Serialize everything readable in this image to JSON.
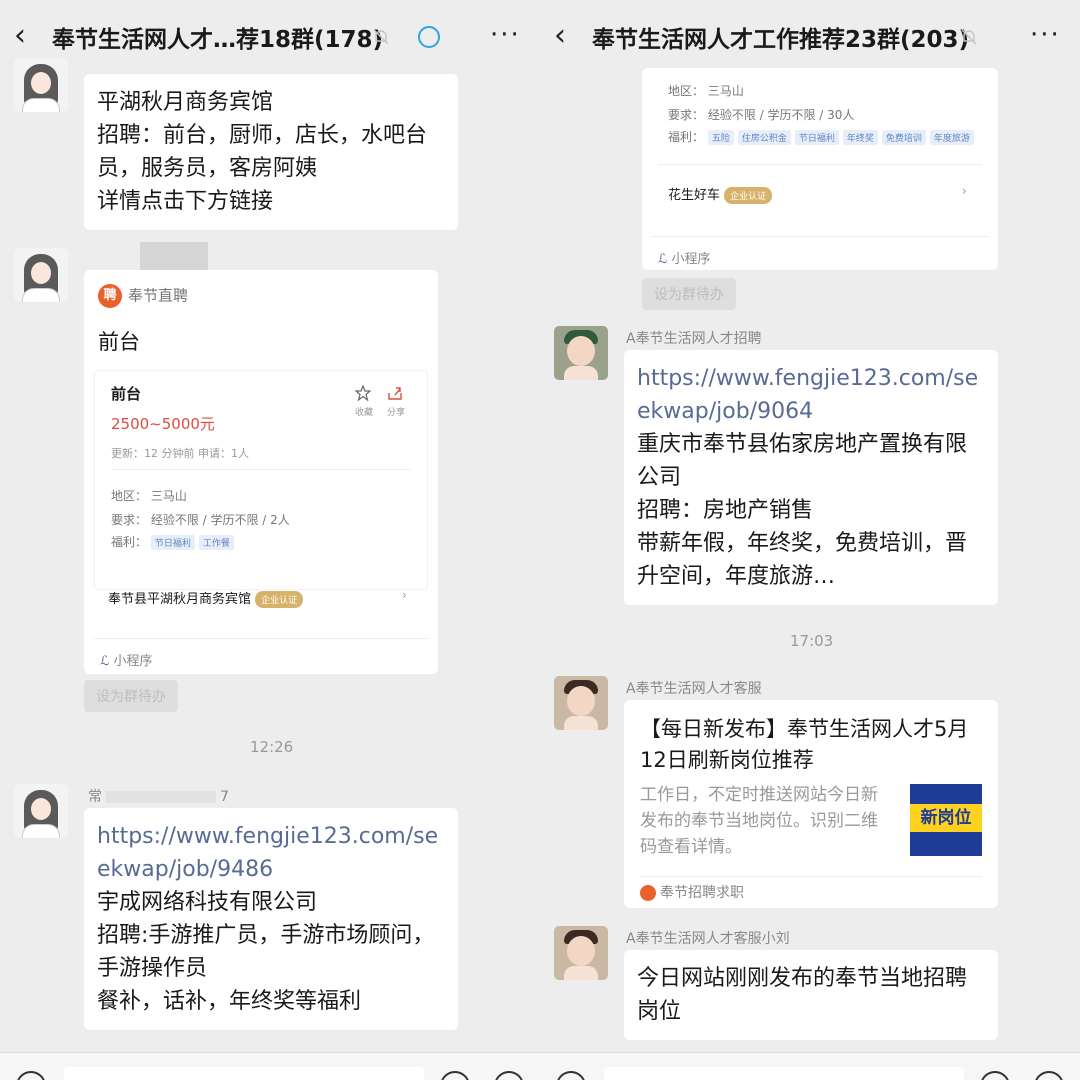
{
  "left": {
    "header": {
      "back": "‹",
      "title": "奉节生活网人才…荐18群(178)",
      "more": "···"
    },
    "msg1": {
      "lines": [
        "平湖秋月商务宾馆",
        "招聘：前台，厨师，店长，水吧台",
        "员，服务员，客房阿姨",
        "详情点击下方链接"
      ]
    },
    "card": {
      "source": "奉节直聘",
      "source_logo": "聘",
      "title": "前台",
      "job_title": "前台",
      "salary": "2500~5000元",
      "fav": "收藏",
      "share": "分享",
      "meta": "更新：12 分钟前      申请：1人",
      "area": "地区：  三马山",
      "req": "要求：  经验不限 / 学历不限 / 2人",
      "welfare_label": "福利：",
      "welfare": [
        "节日福利",
        "工作餐"
      ],
      "company": "奉节县平湖秋月商务宾馆",
      "company_badge": "企业认证",
      "mini": "小程序"
    },
    "pin": "设为群待办",
    "time": "12:26",
    "sender2": "常",
    "sender2_tail": "7",
    "msg2": {
      "link": "https://www.fengjie123.com/seekwap/job/9486",
      "lines": [
        "宇成网络科技有限公司",
        "招聘:手游推广员，手游市场顾问，",
        "手游操作员",
        "餐补，话补，年终奖等福利"
      ]
    }
  },
  "right": {
    "header": {
      "back": "‹",
      "title": "奉节生活网人才工作推荐23群(203)",
      "more": "···"
    },
    "card_top": {
      "area": "地区：  三马山",
      "req": "要求：  经验不限 / 学历不限 / 30人",
      "welfare_label": "福利：",
      "welfare": [
        "五险",
        "住房公积金",
        "节日福利",
        "年终奖",
        "免费培训",
        "年度旅游"
      ],
      "company": "花生好车",
      "company_badge": "企业认证",
      "mini": "小程序"
    },
    "pin": "设为群待办",
    "sender1": "A奉节生活网人才招聘",
    "msg1": {
      "link": "https://www.fengjie123.com/seekwap/job/9064",
      "lines": [
        "重庆市奉节县佑家房地产置换有限",
        "公司",
        "招聘：房地产销售",
        "带薪年假，年终奖，免费培训，晋",
        "升空间，年度旅游…"
      ]
    },
    "time": "17:03",
    "sender2": "A奉节生活网人才客服",
    "article": {
      "title": "【每日新发布】奉节生活网人才5月12日刷新岗位推荐",
      "desc": "工作日，不定时推送网站今日新发布的奉节当地岗位。识别二维码查看详情。",
      "thumb_text": "新岗位",
      "source": "奉节招聘求职"
    },
    "sender3": "A奉节生活网人才客服小刘",
    "msg3": {
      "text": "今日网站刚刚发布的奉节当地招聘岗位"
    }
  },
  "colors": {
    "bg": "#ededed",
    "link": "#576b95",
    "salary": "#e04b3b",
    "accent_ring": "#2aa7e0"
  }
}
